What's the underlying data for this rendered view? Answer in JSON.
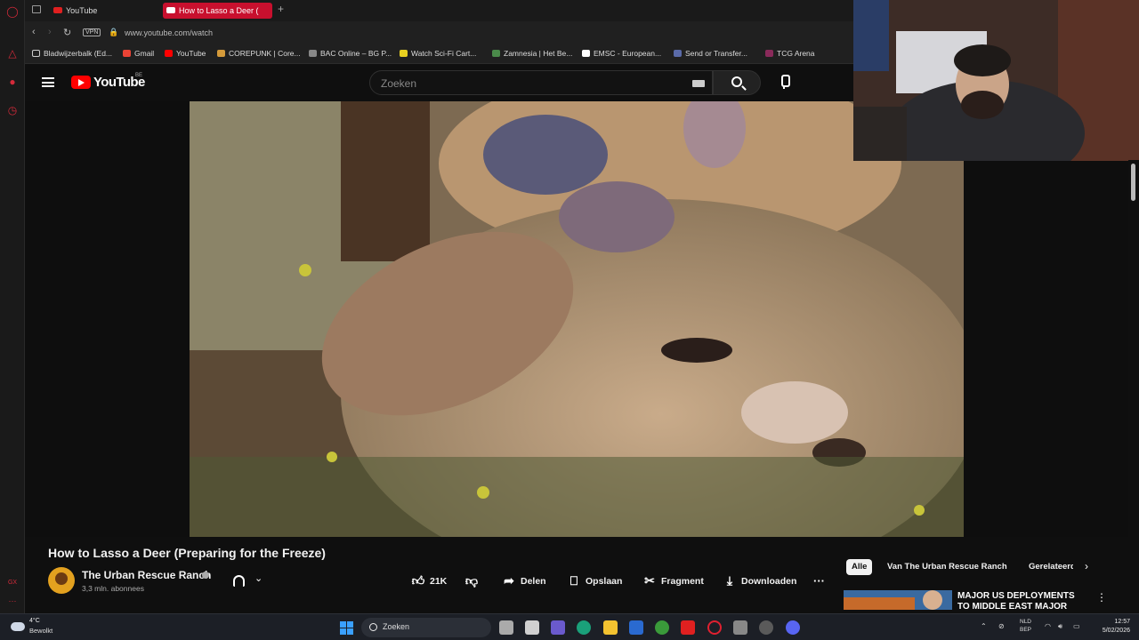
{
  "browser": {
    "tabs": [
      {
        "label": "YouTube",
        "active": false
      },
      {
        "label": "How to Lasso a Deer (",
        "active": true
      }
    ],
    "address": {
      "vpn_label": "VPN",
      "url": "www.youtube.com/watch"
    },
    "bookmarks": [
      {
        "label": "Bladwijzerbalk (Ed...",
        "icon": "folder-icon"
      },
      {
        "label": "Gmail",
        "icon": "gmail-icon"
      },
      {
        "label": "YouTube",
        "icon": "youtube-icon"
      },
      {
        "label": "COREPUNK | Core...",
        "icon": "corepunk-icon"
      },
      {
        "label": "BAC Online – BG P...",
        "icon": "bac-icon"
      },
      {
        "label": "Watch Sci-Fi Cart...",
        "icon": "scifi-icon"
      },
      {
        "label": "Zamnesia | Het Be...",
        "icon": "zamnesia-icon"
      },
      {
        "label": "EMSC - European...",
        "icon": "emsc-icon"
      },
      {
        "label": "Send or Transfer...",
        "icon": "transfer-icon"
      },
      {
        "label": "TCG Arena",
        "icon": "tcg-icon"
      }
    ]
  },
  "youtube": {
    "logo_text": "YouTube",
    "country": "BE",
    "search_placeholder": "Zoeken",
    "video": {
      "title": "How to Lasso a Deer (Preparing for the Freeze)",
      "channel": "The Urban Rescue Ranch",
      "subscribers": "3,3 mln. abonnees",
      "likes": "21K",
      "actions": {
        "share": "Delen",
        "save": "Opslaan",
        "clip": "Fragment",
        "download": "Downloaden"
      }
    },
    "chips": [
      "Alle",
      "Van The Urban Rescue Ranch",
      "Gerelateerd"
    ],
    "related": {
      "title": "MAJOR US DEPLOYMENTS TO MIDDLE EAST MAJOR SHIP..."
    }
  },
  "taskbar": {
    "temperature": "4°C",
    "weather": "Bewolkt",
    "search_label": "Zoeken",
    "lang_line1": "NLD",
    "lang_line2": "BEP",
    "time": "12:57",
    "date": "5/02/2026"
  },
  "colors": {
    "opera_red": "#d42a3a",
    "youtube_red": "#ff0000",
    "background": "#0f0f0f"
  }
}
